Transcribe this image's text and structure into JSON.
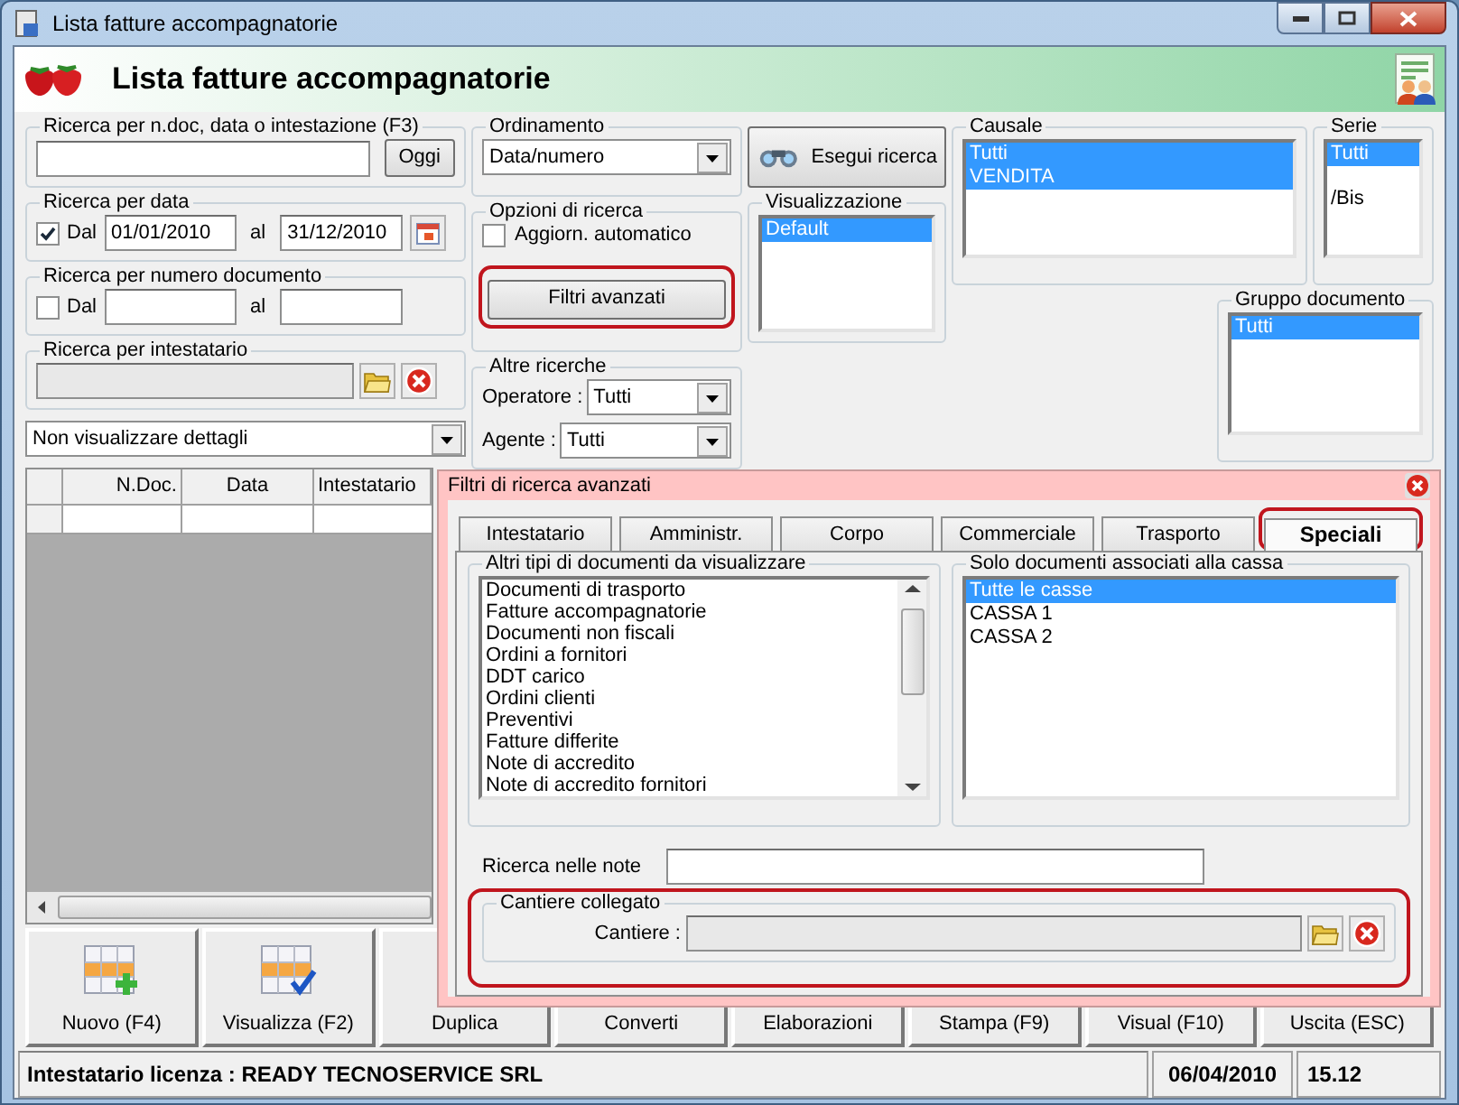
{
  "window": {
    "title": "Lista fatture accompagnatorie"
  },
  "header": {
    "title": "Lista fatture accompagnatorie"
  },
  "quick_search": {
    "legend": "Ricerca per n.doc, data o intestazione (F3)",
    "button": "Oggi"
  },
  "date_search": {
    "legend": "Ricerca per data",
    "checked": true,
    "from_label": "Dal",
    "from": "01/01/2010",
    "to_label": "al",
    "to": "31/12/2010"
  },
  "number_search": {
    "legend": "Ricerca per numero documento",
    "checked": false,
    "from_label": "Dal",
    "to_label": "al"
  },
  "holder_search": {
    "legend": "Ricerca per intestatario"
  },
  "details_select": {
    "value": "Non visualizzare dettagli"
  },
  "table": {
    "columns": [
      "N.Doc.",
      "Data",
      "Intestatario"
    ]
  },
  "ordering": {
    "legend": "Ordinamento",
    "value": "Data/numero"
  },
  "options": {
    "legend": "Opzioni di ricerca",
    "auto_update": {
      "label": "Aggiorn. automatico",
      "checked": false
    },
    "advanced_button": {
      "label": "Filtri avanzati",
      "highlighted": true
    }
  },
  "other_searches": {
    "legend": "Altre ricerche",
    "fields": [
      {
        "label": "Operatore :",
        "value": "Tutti"
      },
      {
        "label": "Agente :",
        "value": "Tutti"
      }
    ]
  },
  "search_button": {
    "label": "Esegui ricerca"
  },
  "display": {
    "legend": "Visualizzazione",
    "items": [
      {
        "label": "Default",
        "selected": true
      }
    ]
  },
  "causale": {
    "legend": "Causale",
    "items": [
      {
        "label": "Tutti",
        "selected": true
      },
      {
        "label": "VENDITA",
        "selected": true
      }
    ]
  },
  "serie": {
    "legend": "Serie",
    "items": [
      {
        "label": "Tutti",
        "selected": true
      },
      {
        "label": "/Bis",
        "selected": false
      }
    ]
  },
  "gruppo": {
    "legend": "Gruppo documento",
    "items": [
      {
        "label": "Tutti",
        "selected": true
      }
    ]
  },
  "buttons": [
    {
      "label": "Nuovo (F4)",
      "kind": "new"
    },
    {
      "label": "Visualizza (F2)",
      "kind": "view"
    },
    {
      "label": "Duplica",
      "kind": "plain"
    },
    {
      "label": "Converti",
      "kind": "plain"
    },
    {
      "label": "Elaborazioni",
      "kind": "plain"
    },
    {
      "label": "Stampa (F9)",
      "kind": "plain"
    },
    {
      "label": "Visual (F10)",
      "kind": "plain"
    },
    {
      "label": "Uscita (ESC)",
      "kind": "plain"
    }
  ],
  "status_bar": {
    "license": "Intestatario licenza : READY TECNOSERVICE SRL",
    "date": "06/04/2010",
    "time": "15.12"
  },
  "advanced": {
    "title": "Filtri di ricerca avanzati",
    "tabs": [
      {
        "label": "Intestatario",
        "selected": false,
        "highlighted": false
      },
      {
        "label": "Amministr.",
        "selected": false,
        "highlighted": false
      },
      {
        "label": "Corpo",
        "selected": false,
        "highlighted": false
      },
      {
        "label": "Commerciale",
        "selected": false,
        "highlighted": false
      },
      {
        "label": "Trasporto",
        "selected": false,
        "highlighted": false
      },
      {
        "label": "Speciali",
        "selected": true,
        "highlighted": true
      }
    ],
    "doc_types": {
      "legend": "Altri tipi di documenti da visualizzare",
      "items": [
        {
          "label": "Documenti di trasporto",
          "selected": false
        },
        {
          "label": "Fatture accompagnatorie",
          "selected": false
        },
        {
          "label": "Documenti non fiscali",
          "selected": false
        },
        {
          "label": "Ordini a fornitori",
          "selected": false
        },
        {
          "label": "DDT carico",
          "selected": false
        },
        {
          "label": "Ordini clienti",
          "selected": false
        },
        {
          "label": "Preventivi",
          "selected": false
        },
        {
          "label": "Fatture differite",
          "selected": false
        },
        {
          "label": "Note di accredito",
          "selected": false
        },
        {
          "label": "Note di accredito fornitori",
          "selected": false
        }
      ]
    },
    "cassa": {
      "legend": "Solo documenti associati alla cassa",
      "items": [
        {
          "label": "Tutte le casse",
          "selected": true
        },
        {
          "label": "CASSA 1",
          "selected": false
        },
        {
          "label": "CASSA 2",
          "selected": false
        }
      ]
    },
    "notes_label": "Ricerca nelle note",
    "cantiere": {
      "legend": "Cantiere collegato",
      "label": "Cantiere :",
      "highlighted": true
    }
  }
}
